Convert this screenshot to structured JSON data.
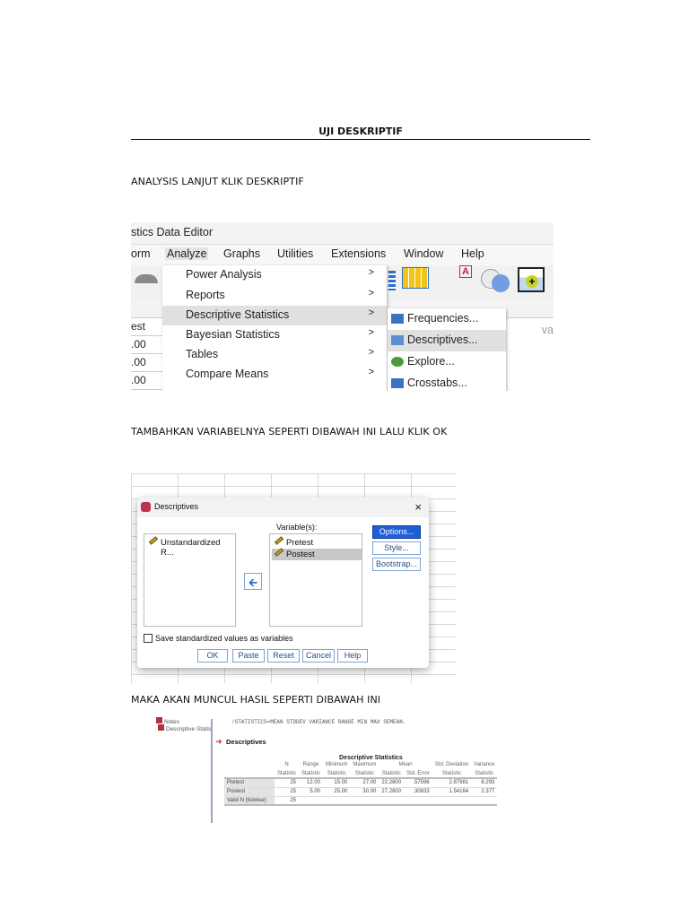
{
  "document": {
    "title": "UJI DESKRIPTIF",
    "step1": "ANALYSIS LANJUT KLIK DESKRIPTIF",
    "step2": "TAMBAHKAN VARIABELNYA SEPERTI DIBAWAH INI LALU KLIK OK",
    "step3": "MAKA AKAN MUNCUL HASIL SEPERTI DIBAWAH INI"
  },
  "spss_menu": {
    "window_title": "stics Data Editor",
    "menubar": [
      "orm",
      "Analyze",
      "Graphs",
      "Utilities",
      "Extensions",
      "Window",
      "Help"
    ],
    "analyze_menu": [
      "Power Analysis",
      "Reports",
      "Descriptive Statistics",
      "Bayesian Statistics",
      "Tables",
      "Compare Means"
    ],
    "submenu": [
      "Frequencies...",
      "Descriptives...",
      "Explore...",
      "Crosstabs..."
    ],
    "grid_header": "est",
    "grid_header_right": "va",
    "grid_values": [
      ".00",
      ".00",
      ".00"
    ],
    "arrow": ">"
  },
  "descriptives_dialog": {
    "title": "Descriptives",
    "close": "×",
    "source_vars": [
      "Unstandardized R..."
    ],
    "variables_label": "Variable(s):",
    "selected_vars": [
      "Pretest",
      "Postest"
    ],
    "side_buttons": [
      "Options...",
      "Style...",
      "Bootstrap..."
    ],
    "move_arrow": "🡨",
    "checkbox_label": "Save standardized values as variables",
    "bottom_buttons": [
      "OK",
      "Paste",
      "Reset",
      "Cancel",
      "Help"
    ]
  },
  "output": {
    "tree": [
      "Notes",
      "Descriptive Statist"
    ],
    "syntax": "/STATISTICS=MEAN STDDEV VARIANCE RANGE MIN MAX SEMEAN.",
    "heading": "Descriptives",
    "table_title": "Descriptive Statistics",
    "header_top": [
      "N",
      "Range",
      "Minimum",
      "Maximum",
      "Mean",
      "Std. Deviation",
      "Variance"
    ],
    "header_sub": [
      "Statistic",
      "Statistic",
      "Statistic",
      "Statistic",
      "Statistic",
      "Std. Error",
      "Statistic",
      "Statistic"
    ],
    "rows": [
      {
        "label": "Pretest",
        "values": [
          "25",
          "12.00",
          "15.00",
          "27.00",
          "22.2800",
          ".57596",
          "2.87981",
          "8.293"
        ]
      },
      {
        "label": "Postest",
        "values": [
          "25",
          "5.00",
          "25.00",
          "30.00",
          "27.2800",
          ".30833",
          "1.54164",
          "2.377"
        ]
      },
      {
        "label": "Valid N (listwise)",
        "values": [
          "25",
          "",
          "",
          "",
          "",
          "",
          "",
          ""
        ]
      }
    ]
  }
}
